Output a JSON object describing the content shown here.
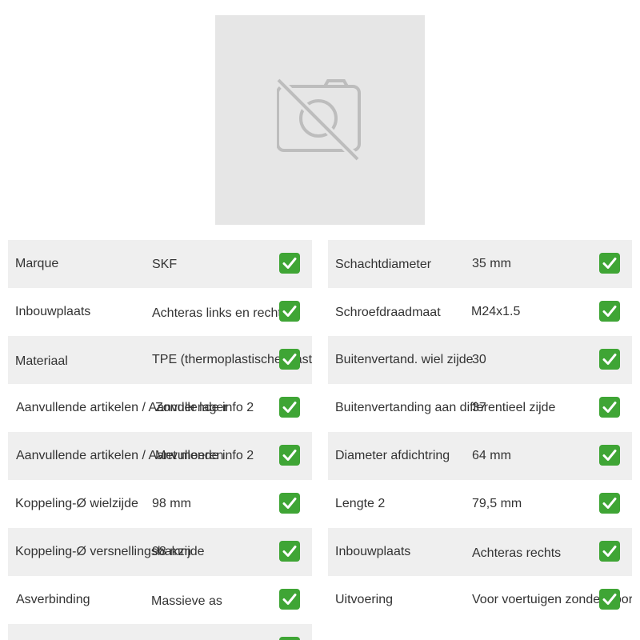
{
  "image": {
    "icon": "no-photo-icon"
  },
  "colors": {
    "row_shade": "#efefef",
    "check_green": "#3fa535",
    "placeholder_bg": "#e6e6e6"
  },
  "specs_left": [
    {
      "label": "Marque",
      "value": "SKF"
    },
    {
      "label": "Inbouwplaats",
      "value": "Achteras links en rechts"
    },
    {
      "label": "Materiaal",
      "value": "TPE (thermoplastische elastomeren)"
    },
    {
      "label": "Aanvullende artikelen / Aanvullende info 2",
      "value": "Zonder lager"
    },
    {
      "label": "Aanvullende artikelen / Aanvullende info 2",
      "value": "Met moeren"
    },
    {
      "label": "Koppeling-Ø wielzijde",
      "value": "98 mm"
    },
    {
      "label": "Koppeling-Ø versnellingsbakzijde",
      "value": "98 mm"
    },
    {
      "label": "Asverbinding",
      "value": "Massieve as"
    },
    {
      "label": "",
      "value": ""
    }
  ],
  "specs_right": [
    {
      "label": "Schachtdiameter",
      "value": "35 mm"
    },
    {
      "label": "Schroefdraadmaat",
      "value": "M24x1.5"
    },
    {
      "label": "Buitenvertand. wiel zijde",
      "value": "30"
    },
    {
      "label": "Buitenvertanding aan differentieel zijde",
      "value": "37"
    },
    {
      "label": "Diameter afdichtring",
      "value": "64 mm"
    },
    {
      "label": "Lengte 2",
      "value": "79,5 mm"
    },
    {
      "label": "Inbouwplaats",
      "value": "Achteras rechts"
    },
    {
      "label": "Uitvoering",
      "value": "Voor voertuigen zonder sport-pakket"
    }
  ]
}
